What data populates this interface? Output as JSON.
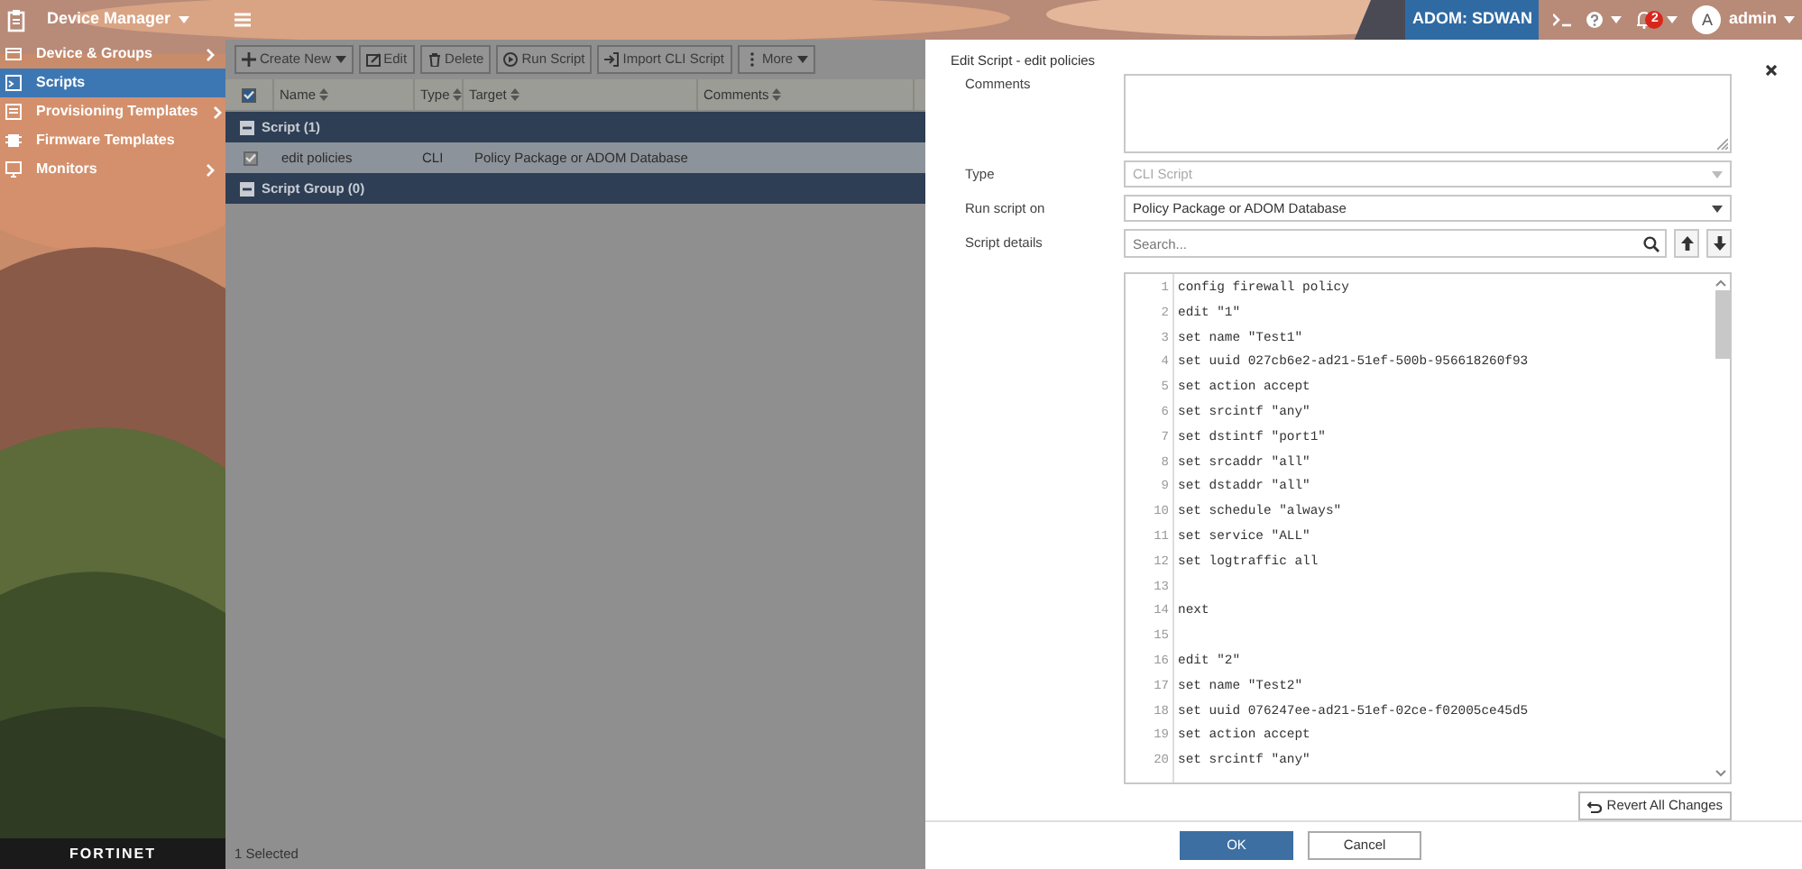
{
  "topbar": {
    "app_title": "Device Manager",
    "adom": "ADOM: SDWAN",
    "notification_count": "2",
    "avatar": "A",
    "user": "admin"
  },
  "sidebar": {
    "items": [
      {
        "label": "Device & Groups",
        "selected": false,
        "has_submenu": true
      },
      {
        "label": "Scripts",
        "selected": true,
        "has_submenu": false
      },
      {
        "label": "Provisioning Templates",
        "selected": false,
        "has_submenu": true
      },
      {
        "label": "Firmware Templates",
        "selected": false,
        "has_submenu": false
      },
      {
        "label": "Monitors",
        "selected": false,
        "has_submenu": true
      }
    ],
    "logo": "FORTINET"
  },
  "toolbar": [
    {
      "label": "Create New",
      "dropdown": true
    },
    {
      "label": "Edit",
      "dropdown": false
    },
    {
      "label": "Delete",
      "dropdown": false
    },
    {
      "label": "Run Script",
      "dropdown": false
    },
    {
      "label": "Import CLI Script",
      "dropdown": false
    },
    {
      "label": "More",
      "dropdown": true
    }
  ],
  "table": {
    "header_checked": true,
    "columns": [
      "Name",
      "Type",
      "Target",
      "Comments"
    ],
    "groups": [
      {
        "label": "Script (1)",
        "expanded": true,
        "rows": [
          {
            "selected": true,
            "name": "edit policies",
            "type": "CLI",
            "target": "Policy Package or ADOM Database"
          }
        ]
      },
      {
        "label": "Script Group (0)",
        "expanded": true
      }
    ]
  },
  "status_bar": "1 Selected",
  "dialog": {
    "title": "Edit Script - edit policies",
    "fields": [
      {
        "kind": "textarea",
        "label": "Comments"
      },
      {
        "kind": "select",
        "label": "Type",
        "value": "CLI Script",
        "disabled": true
      },
      {
        "kind": "select",
        "label": "Run script on",
        "value": "Policy Package or ADOM Database",
        "disabled": false
      },
      {
        "kind": "search",
        "label": "Script details",
        "placeholder": "Search..."
      }
    ],
    "code_lines": [
      {
        "number": "1",
        "text": "config firewall policy"
      },
      {
        "number": "2",
        "text": "edit \"1\""
      },
      {
        "number": "3",
        "text": "set name \"Test1\""
      },
      {
        "number": "4",
        "text": "set uuid 027cb6e2-ad21-51ef-500b-956618260f93"
      },
      {
        "number": "5",
        "text": "set action accept"
      },
      {
        "number": "6",
        "text": "set srcintf \"any\""
      },
      {
        "number": "7",
        "text": "set dstintf \"port1\""
      },
      {
        "number": "8",
        "text": "set srcaddr \"all\""
      },
      {
        "number": "9",
        "text": "set dstaddr \"all\""
      },
      {
        "number": "10",
        "text": "set schedule \"always\""
      },
      {
        "number": "11",
        "text": "set service \"ALL\""
      },
      {
        "number": "12",
        "text": "set logtraffic all"
      },
      {
        "number": "13"
      },
      {
        "number": "14",
        "text": "next"
      },
      {
        "number": "15"
      },
      {
        "number": "16",
        "text": "edit \"2\""
      },
      {
        "number": "17",
        "text": "set name \"Test2\""
      },
      {
        "number": "18",
        "text": "set uuid 076247ee-ad21-51ef-02ce-f02005ce45d5"
      },
      {
        "number": "19",
        "text": "set action accept"
      },
      {
        "number": "20",
        "text": "set srcintf \"any\""
      }
    ],
    "revert_button": "Revert All Changes",
    "buttons": [
      {
        "label": "OK",
        "primary": true
      },
      {
        "label": "Cancel",
        "primary": false
      }
    ]
  }
}
